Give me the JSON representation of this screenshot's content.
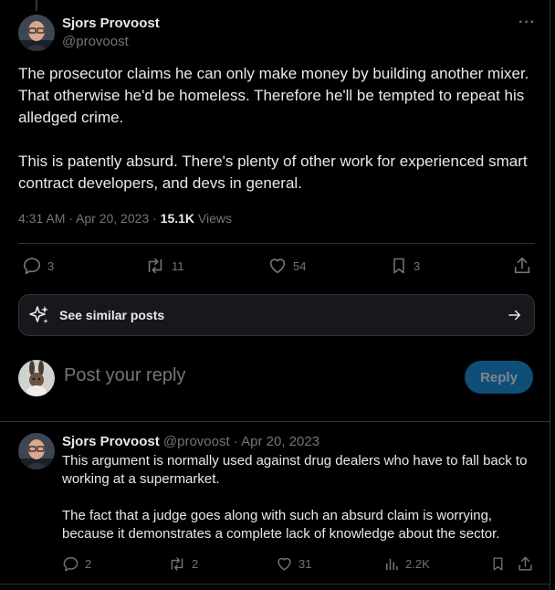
{
  "tweet": {
    "author_name": "Sjors Provoost",
    "author_handle": "@provoost",
    "more_label": "···",
    "text": "The prosecutor claims he can only make money by building another mixer. That otherwise he'd be homeless. Therefore he'll be tempted to repeat his alledged crime.\n\nThis is patently absurd. There's plenty of other work for experienced smart contract developers, and devs in general.",
    "time": "4:31 AM · Apr 20, 2023 · ",
    "views_count": "15.1K",
    "views_label": " Views",
    "replies": "3",
    "reposts": "11",
    "likes": "54",
    "bookmarks": "3"
  },
  "similar": {
    "label": "See similar posts"
  },
  "composer": {
    "placeholder": "Post your reply",
    "button_label": "Reply"
  },
  "reply": {
    "author_name": "Sjors Provoost",
    "author_handle": "@provoost",
    "date": " · Apr 20, 2023",
    "text": "This argument is normally used against drug dealers who have to fall back to working at a supermarket.\n\nThe fact that a judge goes along with such an absurd claim is worrying, because it demonstrates a complete lack of knowledge about the sector.",
    "replies": "2",
    "reposts": "2",
    "likes": "31",
    "views": "2.2K"
  },
  "colors": {
    "background": "#000000",
    "text": "#e7e9ea",
    "muted": "#71767b",
    "border": "#2f3336",
    "reply_button": "#0f4e78"
  }
}
